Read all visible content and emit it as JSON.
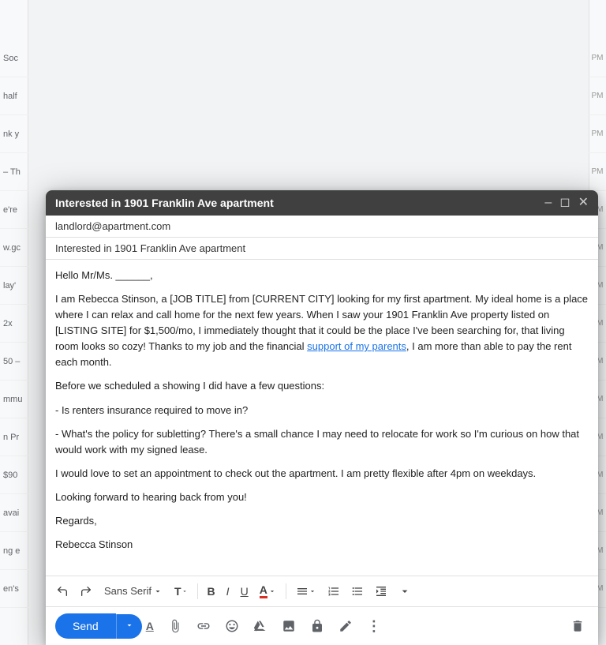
{
  "background": {
    "left_labels": [
      "Soc",
      "half",
      "nk y",
      "– Th",
      "e're",
      "w.gc",
      "lay'",
      "2x",
      "50 –",
      "mmu",
      "n Pr",
      "$90",
      "avai",
      "ng e",
      "en's"
    ],
    "right_times": [
      "PM",
      "PM",
      "PM",
      "PM",
      "PM",
      "AM",
      "AM",
      "AM",
      "AM",
      "AM",
      "AM",
      "AM",
      "AM",
      "AM",
      "AM"
    ]
  },
  "compose": {
    "title": "Interested in 1901 Franklin Ave apartment",
    "to": "landlord@apartment.com",
    "subject": "Interested in 1901 Franklin Ave apartment",
    "body_greeting": "Hello Mr/Ms. ______,",
    "body_paragraph1": "I am Rebecca Stinson, a [JOB TITLE] from [CURRENT CITY] looking for my first apartment. My ideal home is a place where I can relax and call home for the next few years. When I saw your 1901 Franklin Ave property listed on [LISTING SITE] for $1,500/mo, I immediately thought that it could be the place I've been searching for, that living room looks so cozy! Thanks to my job and the financial ",
    "body_link": "support of my parents",
    "body_paragraph1_end": ", I am more than able to pay the rent each month.",
    "body_paragraph2": "Before we scheduled a showing I did have a few questions:",
    "body_question1": "- Is renters insurance required to move in?",
    "body_question2": "- What's the policy for subletting? There's a small chance I may need to relocate for work so I'm curious on how that would work with my signed lease.",
    "body_paragraph3": "I would love to set an appointment to check out the apartment. I am pretty flexible after 4pm on weekdays.",
    "body_closing": "Looking forward to hearing back from you!",
    "body_regards": "Regards,",
    "body_signature": "Rebecca Stinson",
    "toolbar": {
      "undo_label": "↩",
      "redo_label": "↪",
      "font_name": "Sans Serif",
      "font_size": "T",
      "bold": "B",
      "italic": "I",
      "underline": "U",
      "text_color": "A",
      "align": "≡",
      "numbered_list": "ol",
      "bullet_list": "ul",
      "indent": "⇥",
      "more": "⋯"
    },
    "actions": {
      "send_label": "Send",
      "formatting_label": "A",
      "attach_label": "📎",
      "link_label": "🔗",
      "emoji_label": "😊",
      "drive_label": "△",
      "photo_label": "🖼",
      "lock_label": "🔒",
      "signature_label": "✏",
      "more_label": "⋮",
      "delete_label": "🗑"
    }
  }
}
